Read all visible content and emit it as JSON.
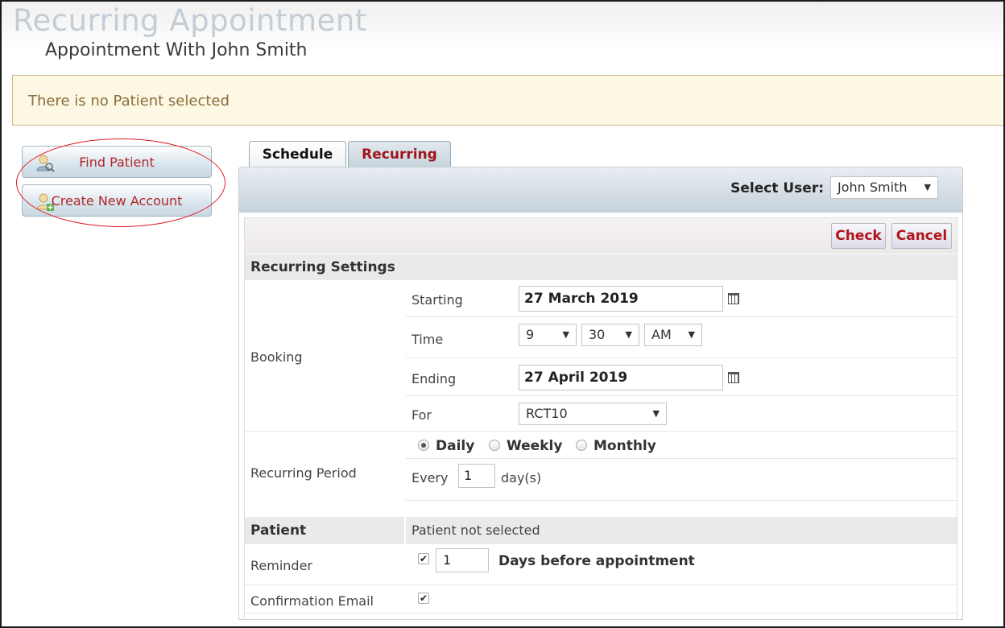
{
  "header": {
    "title": "Recurring Appointment",
    "subtitle": "Appointment With John Smith"
  },
  "notice": {
    "text": "There is no Patient selected"
  },
  "sidebar": {
    "find_patient": "Find Patient",
    "create_account": "Create New Account"
  },
  "tabs": [
    {
      "label": "Schedule",
      "active": true
    },
    {
      "label": "Recurring",
      "active": false
    }
  ],
  "panel": {
    "select_user_label": "Select User:",
    "select_user_value": "John Smith",
    "check_label": "Check",
    "cancel_label": "Cancel"
  },
  "form": {
    "section_recurring": "Recurring Settings",
    "booking_label": "Booking",
    "starting_label": "Starting",
    "starting_value": "27 March 2019",
    "time_label": "Time",
    "time_hour": "9",
    "time_minute": "30",
    "time_ampm": "AM",
    "ending_label": "Ending",
    "ending_value": "27 April 2019",
    "for_label": "For",
    "for_value": "RCT10",
    "recurring_period_label": "Recurring Period",
    "period_options": [
      "Daily",
      "Weekly",
      "Monthly"
    ],
    "period_selected": "Daily",
    "every_label": "Every",
    "every_value": "1",
    "every_unit": "day(s)",
    "patient_label": "Patient",
    "patient_value": "Patient not selected",
    "reminder_label": "Reminder",
    "reminder_checked": true,
    "reminder_days": "1",
    "reminder_text": "Days before appointment",
    "confirmation_label": "Confirmation Email",
    "confirmation_checked": true
  },
  "colors": {
    "accent_red": "#b0141b",
    "annotation_red": "#e31b23",
    "notice_bg": "#fcf8e3",
    "notice_text": "#8a6d3b"
  }
}
